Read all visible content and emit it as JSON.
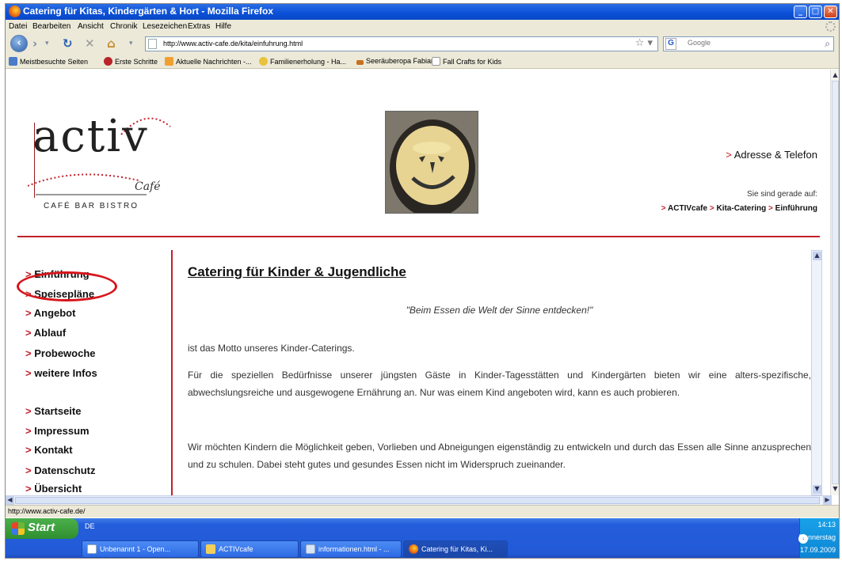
{
  "window": {
    "title": "Catering für Kitas, Kindergärten & Hort - Mozilla Firefox"
  },
  "menu": [
    "Datei",
    "Bearbeiten",
    "Ansicht",
    "Chronik",
    "Lesezeichen",
    "Extras",
    "Hilfe"
  ],
  "nav": {
    "url": "http://www.activ-cafe.de/kita/einfuhrung.html",
    "search_placeholder": "Google",
    "search_engine_icon": "google-icon"
  },
  "bookmarks": [
    "Meistbesuchte Seiten",
    "Erste Schritte",
    "Aktuelle Nachrichten -...",
    "Familienerholung - Ha...",
    "Seeräuberopa Fabian",
    "Fall Crafts for Kids"
  ],
  "header": {
    "logo_main": "activ",
    "logo_sub": "Café",
    "logo_tagline": "CAFÉ BAR BISTRO",
    "arrow": ">",
    "address_link": "Adresse & Telefon",
    "here_label": "Sie sind gerade auf:",
    "breadcrumb": [
      "ACTIVcafe",
      "Kita-Catering",
      "Einführung"
    ]
  },
  "sidebar": {
    "group1": [
      "Einführung",
      "Speisepläne",
      "Angebot",
      "Ablauf",
      "Probewoche",
      "weitere Infos"
    ],
    "group2": [
      "Startseite",
      "Impressum",
      "Kontakt",
      "Datenschutz",
      "Übersicht"
    ]
  },
  "main": {
    "title": "Catering für Kinder & Jugendliche",
    "motto": "\"Beim Essen die Welt der Sinne entdecken!\"",
    "p1": "ist das Motto unseres Kinder-Caterings.",
    "p2": "Für die speziellen Bedürfnisse unserer jüngsten Gäste in Kinder-Tagesstätten und Kindergärten bieten wir eine alters-spezifische, abwechslungsreiche und ausgewogene Ernährung an. Nur was einem Kind angeboten wird, kann es auch probieren.",
    "p3": "Wir möchten Kindern die Möglichkeit geben, Vorlieben und Abneigungen eigenständig zu entwickeln und durch das Essen alle Sinne anzusprechen und zu schulen. Dabei steht gutes und gesundes Essen nicht im Widerspruch zueinander."
  },
  "status": {
    "text": "http://www.activ-cafe.de/"
  },
  "taskbar": {
    "start": "Start",
    "lang": "DE",
    "tasks": [
      "Unbenannt 1 - Open...",
      "ACTIVcafe",
      "informationen.html - ...",
      "Catering für Kitas, Ki..."
    ],
    "time": "14:13",
    "day": "Donnerstag",
    "date": "17.09.2009"
  },
  "colors": {
    "accent_red": "#c0202a",
    "highlight_circle": "#d8141a",
    "xp_blue": "#245ddb"
  }
}
